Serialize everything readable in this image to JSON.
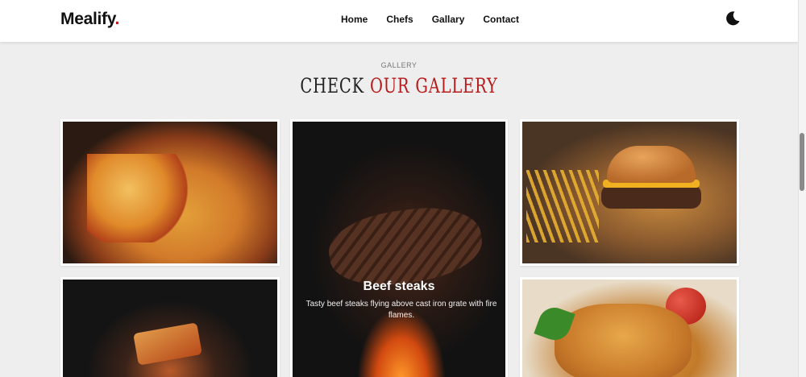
{
  "header": {
    "logo_text": "Mealify",
    "logo_dot": ".",
    "nav": [
      "Home",
      "Chefs",
      "Gallary",
      "Contact"
    ],
    "theme_toggle_icon": "moon-icon"
  },
  "section": {
    "label": "GALLERY",
    "title_plain": "CHECK",
    "title_accent": "OUR GALLERY"
  },
  "gallery": {
    "featured": {
      "title": "Beef steaks",
      "description": "Tasty beef steaks flying above cast iron grate with fire flames."
    }
  },
  "colors": {
    "accent": "#b71c1c",
    "background": "#eeeeee",
    "header": "#ffffff"
  }
}
